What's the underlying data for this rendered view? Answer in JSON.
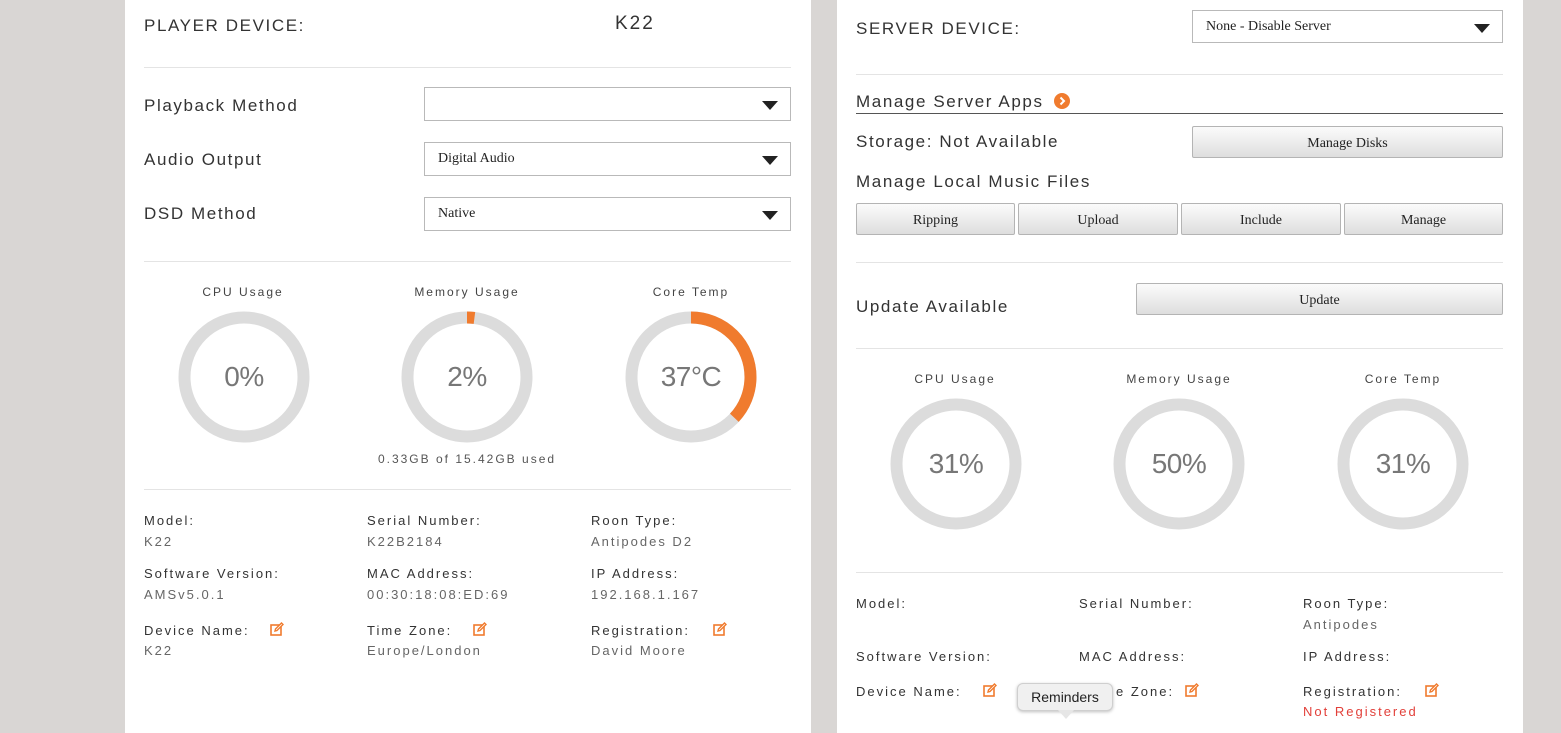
{
  "player": {
    "device_label": "PLAYER DEVICE:",
    "device_value": "K22",
    "playback_method": {
      "label": "Playback Method",
      "value": ""
    },
    "audio_output": {
      "label": "Audio Output",
      "value": "Digital Audio"
    },
    "dsd_method": {
      "label": "DSD Method",
      "value": "Native"
    },
    "gauges": {
      "cpu": {
        "title": "CPU Usage",
        "display": "0%",
        "percent": 0
      },
      "memory": {
        "title": "Memory Usage",
        "display": "2%",
        "percent": 2,
        "subtext": "0.33GB of 15.42GB used"
      },
      "temp": {
        "title": "Core Temp",
        "display": "37°C",
        "percent": 37
      }
    },
    "info": {
      "model_label": "Model:",
      "model": "K22",
      "serial_label": "Serial Number:",
      "serial": "K22B2184",
      "roon_label": "Roon Type:",
      "roon": "Antipodes D2",
      "software_label": "Software Version:",
      "software": "AMSv5.0.1",
      "mac_label": "MAC Address:",
      "mac": "00:30:18:08:ED:69",
      "ip_label": "IP Address:",
      "ip": "192.168.1.167",
      "device_name_label": "Device Name:",
      "device_name": "K22",
      "timezone_label": "Time Zone:",
      "timezone": "Europe/London",
      "registration_label": "Registration:",
      "registration": "David Moore"
    }
  },
  "server": {
    "device_label": "SERVER DEVICE:",
    "device_select": "None - Disable Server",
    "manage_apps": "Manage Server Apps",
    "storage": "Storage: Not Available",
    "manage_disks": "Manage Disks",
    "manage_local": "Manage Local Music Files",
    "buttons": {
      "ripping": "Ripping",
      "upload": "Upload",
      "include": "Include",
      "manage": "Manage"
    },
    "update_label": "Update Available",
    "update_button": "Update",
    "gauges": {
      "cpu": {
        "title": "CPU Usage",
        "display": "31%",
        "percent": 0
      },
      "memory": {
        "title": "Memory Usage",
        "display": "50%",
        "percent": 0
      },
      "temp": {
        "title": "Core Temp",
        "display": "31%",
        "percent": 0
      }
    },
    "info": {
      "model_label": "Model:",
      "serial_label": "Serial Number:",
      "roon_label": "Roon Type:",
      "roon": "Antipodes",
      "software_label": "Software Version:",
      "mac_label": "MAC Address:",
      "ip_label": "IP Address:",
      "device_name_label": "Device Name:",
      "timezone_label": "e Zone:",
      "registration_label": "Registration:",
      "registration": "Not Registered"
    }
  },
  "tooltip": "Reminders",
  "colors": {
    "accent": "#f07b2e",
    "ring": "#dcdcdc",
    "error": "#e2403a"
  },
  "icons": {
    "edit": "edit-icon",
    "chevron": "chevron-right-circle-icon",
    "dropdown": "dropdown-arrow-icon"
  }
}
